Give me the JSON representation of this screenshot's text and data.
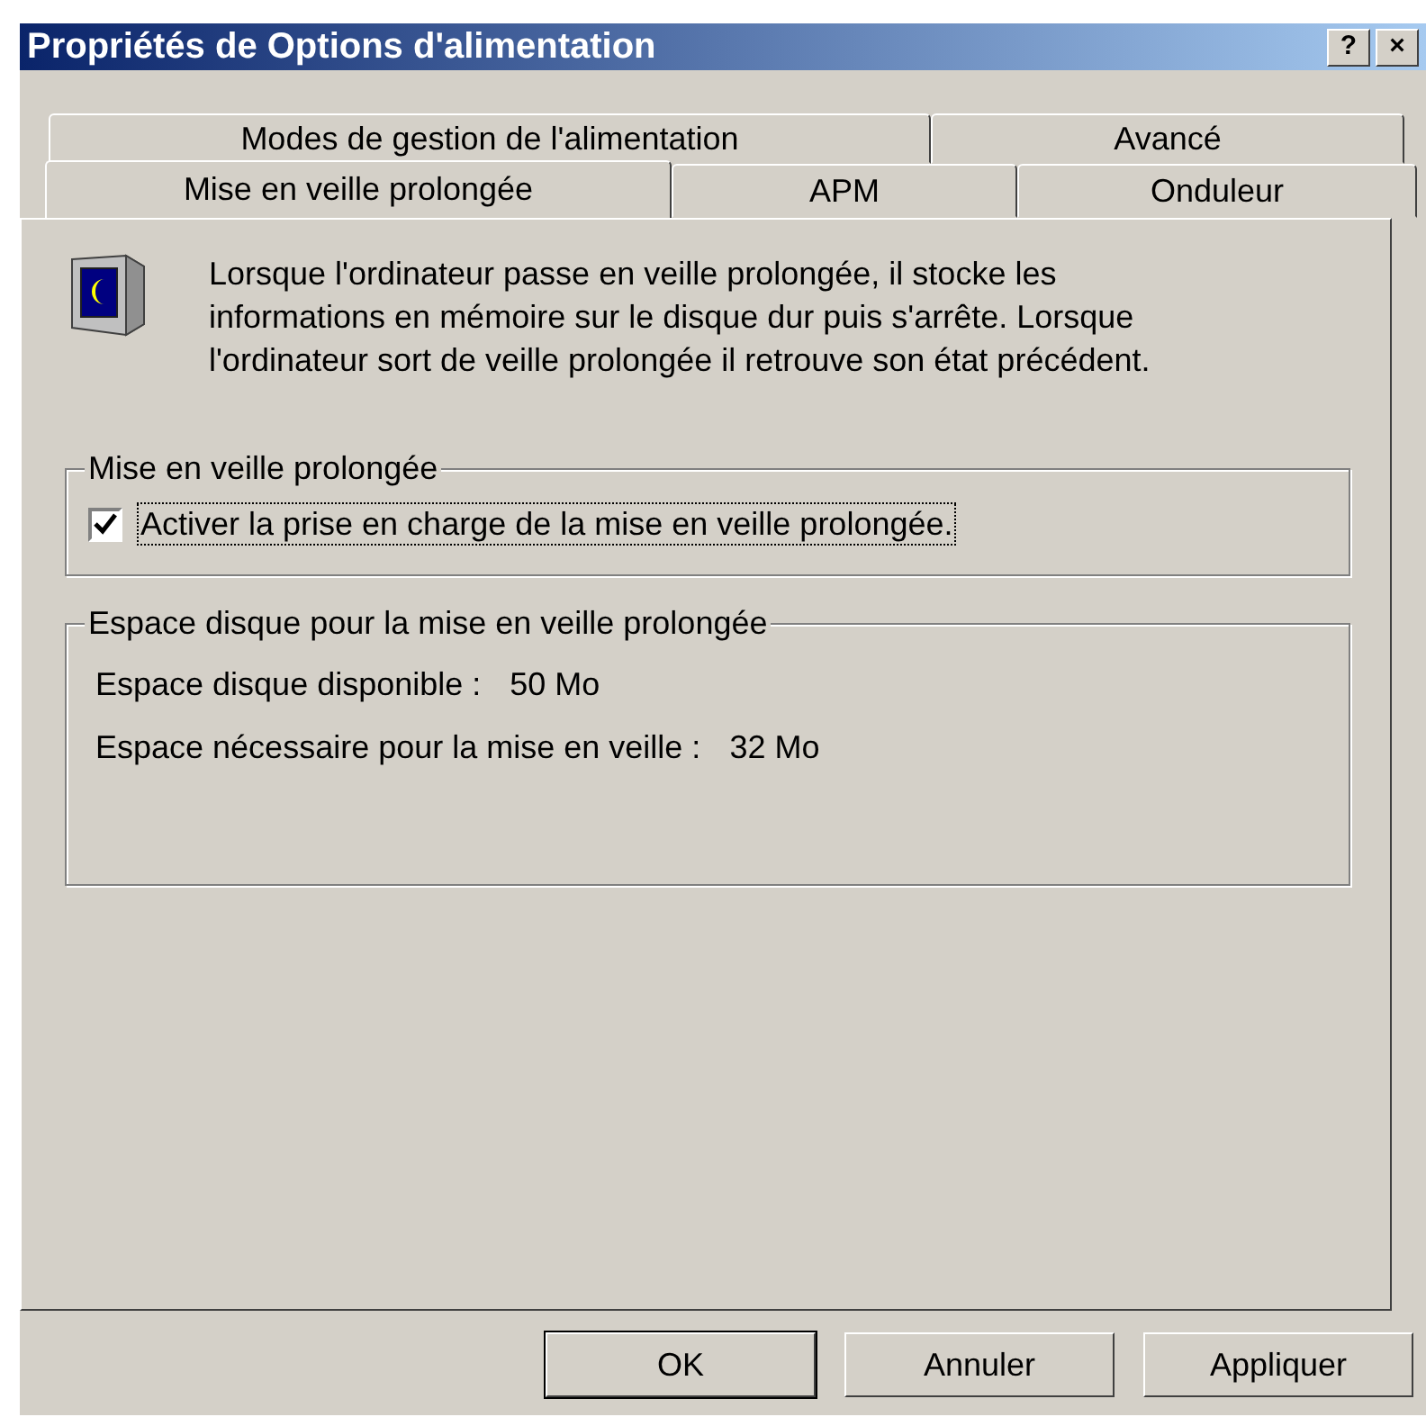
{
  "window": {
    "title": "Propriétés de Options d'alimentation",
    "title_buttons": [
      "?",
      "×"
    ]
  },
  "tab_rows": [
    [
      {
        "label": "Modes de gestion de l'alimentation",
        "selected": false
      },
      {
        "label": "Avancé",
        "selected": false
      }
    ],
    [
      {
        "label": "Mise en veille prolongée",
        "selected": true
      },
      {
        "label": "APM",
        "selected": false
      },
      {
        "label": "Onduleur",
        "selected": false
      }
    ]
  ],
  "description": "Lorsque l'ordinateur passe en veille prolongée, il stocke les informations en mémoire sur le disque dur puis s'arrête. Lorsque l'ordinateur sort de veille prolongée il retrouve son état précédent.",
  "hibernate_group": {
    "title": "Mise en veille prolongée",
    "checkbox": {
      "label": "Activer la prise en charge de la mise en veille prolongée.",
      "checked": true
    }
  },
  "disk_group": {
    "title": "Espace disque pour la mise en veille prolongée",
    "rows": [
      {
        "label": "Espace disque disponible :",
        "value": "50 Mo"
      },
      {
        "label": "Espace nécessaire pour la mise en veille :",
        "value": "32 Mo"
      }
    ]
  },
  "buttons": [
    {
      "label": "OK",
      "default": true
    },
    {
      "label": "Annuler",
      "default": false
    },
    {
      "label": "Appliquer",
      "default": false
    }
  ]
}
